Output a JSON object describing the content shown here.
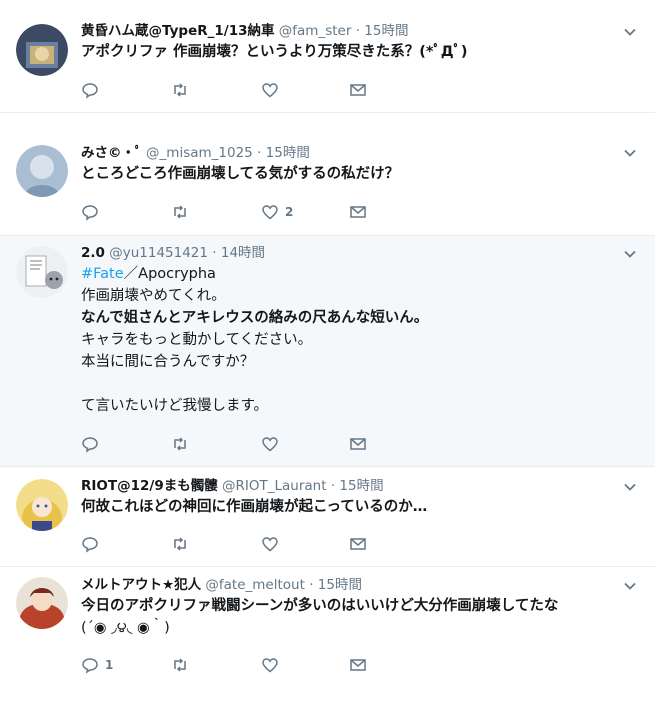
{
  "tweets": [
    {
      "name": "黄昏ハム蔵@TypeR_1/13納車",
      "handle": "@fam_ster",
      "dot": "·",
      "time": "15時間",
      "lines": [
        "アポクリファ 作画崩壊？というより万策尽きた系？(*ﾟДﾟ)"
      ],
      "reply_count": "",
      "like_count": "",
      "avatar_color": "#4a5a7a"
    },
    {
      "name": "みさ©・ﾟ",
      "handle": "@_misam_1025",
      "dot": "·",
      "time": "15時間",
      "lines": [
        "ところどころ作画崩壊してる気がするの私だけ？"
      ],
      "reply_count": "",
      "like_count": "2",
      "avatar_color": "#9eb3c8"
    },
    {
      "name": "2.0",
      "handle": "@yu11451421",
      "dot": "·",
      "time": "14時間",
      "hashtag": "#Fate",
      "after_hashtag": "／Apocrypha",
      "lines": [
        "作画崩壊やめてくれ。",
        "なんで姐さんとアキレウスの絡みの尺あんな短いん。",
        "キャラをもっと動かしてください。",
        "本当に間に合うんですか？",
        "",
        "て言いたいけど我慢します。"
      ],
      "reply_count": "",
      "like_count": "",
      "avatar_color": "#dde3ea"
    },
    {
      "name": "RIOT@12/9まも髑髏",
      "handle": "@RIOT_Laurant",
      "dot": "·",
      "time": "15時間",
      "lines": [
        "何故これほどの神回に作画崩壊が起こっているのか…"
      ],
      "reply_count": "",
      "like_count": "",
      "avatar_color": "#e8c65a"
    },
    {
      "name": "メルトアウト★犯人",
      "handle": "@fate_meltout",
      "dot": "·",
      "time": "15時間",
      "lines": [
        "今日のアポクリファ戦闘シーンが多いのはいいけど大分作画崩壊してたな",
        "(´◉ ◞౪◟ ◉｀)"
      ],
      "reply_count": "1",
      "like_count": "",
      "avatar_color": "#c85a3a"
    }
  ],
  "colors": {
    "accent": "#1da1f2",
    "muted": "#657786",
    "text": "#14171a",
    "highlight_bg": "#f5f8fa"
  },
  "icons": {
    "reply": "reply-icon",
    "retweet": "retweet-icon",
    "like": "heart-icon",
    "dm": "envelope-icon",
    "caret": "chevron-down-icon"
  }
}
